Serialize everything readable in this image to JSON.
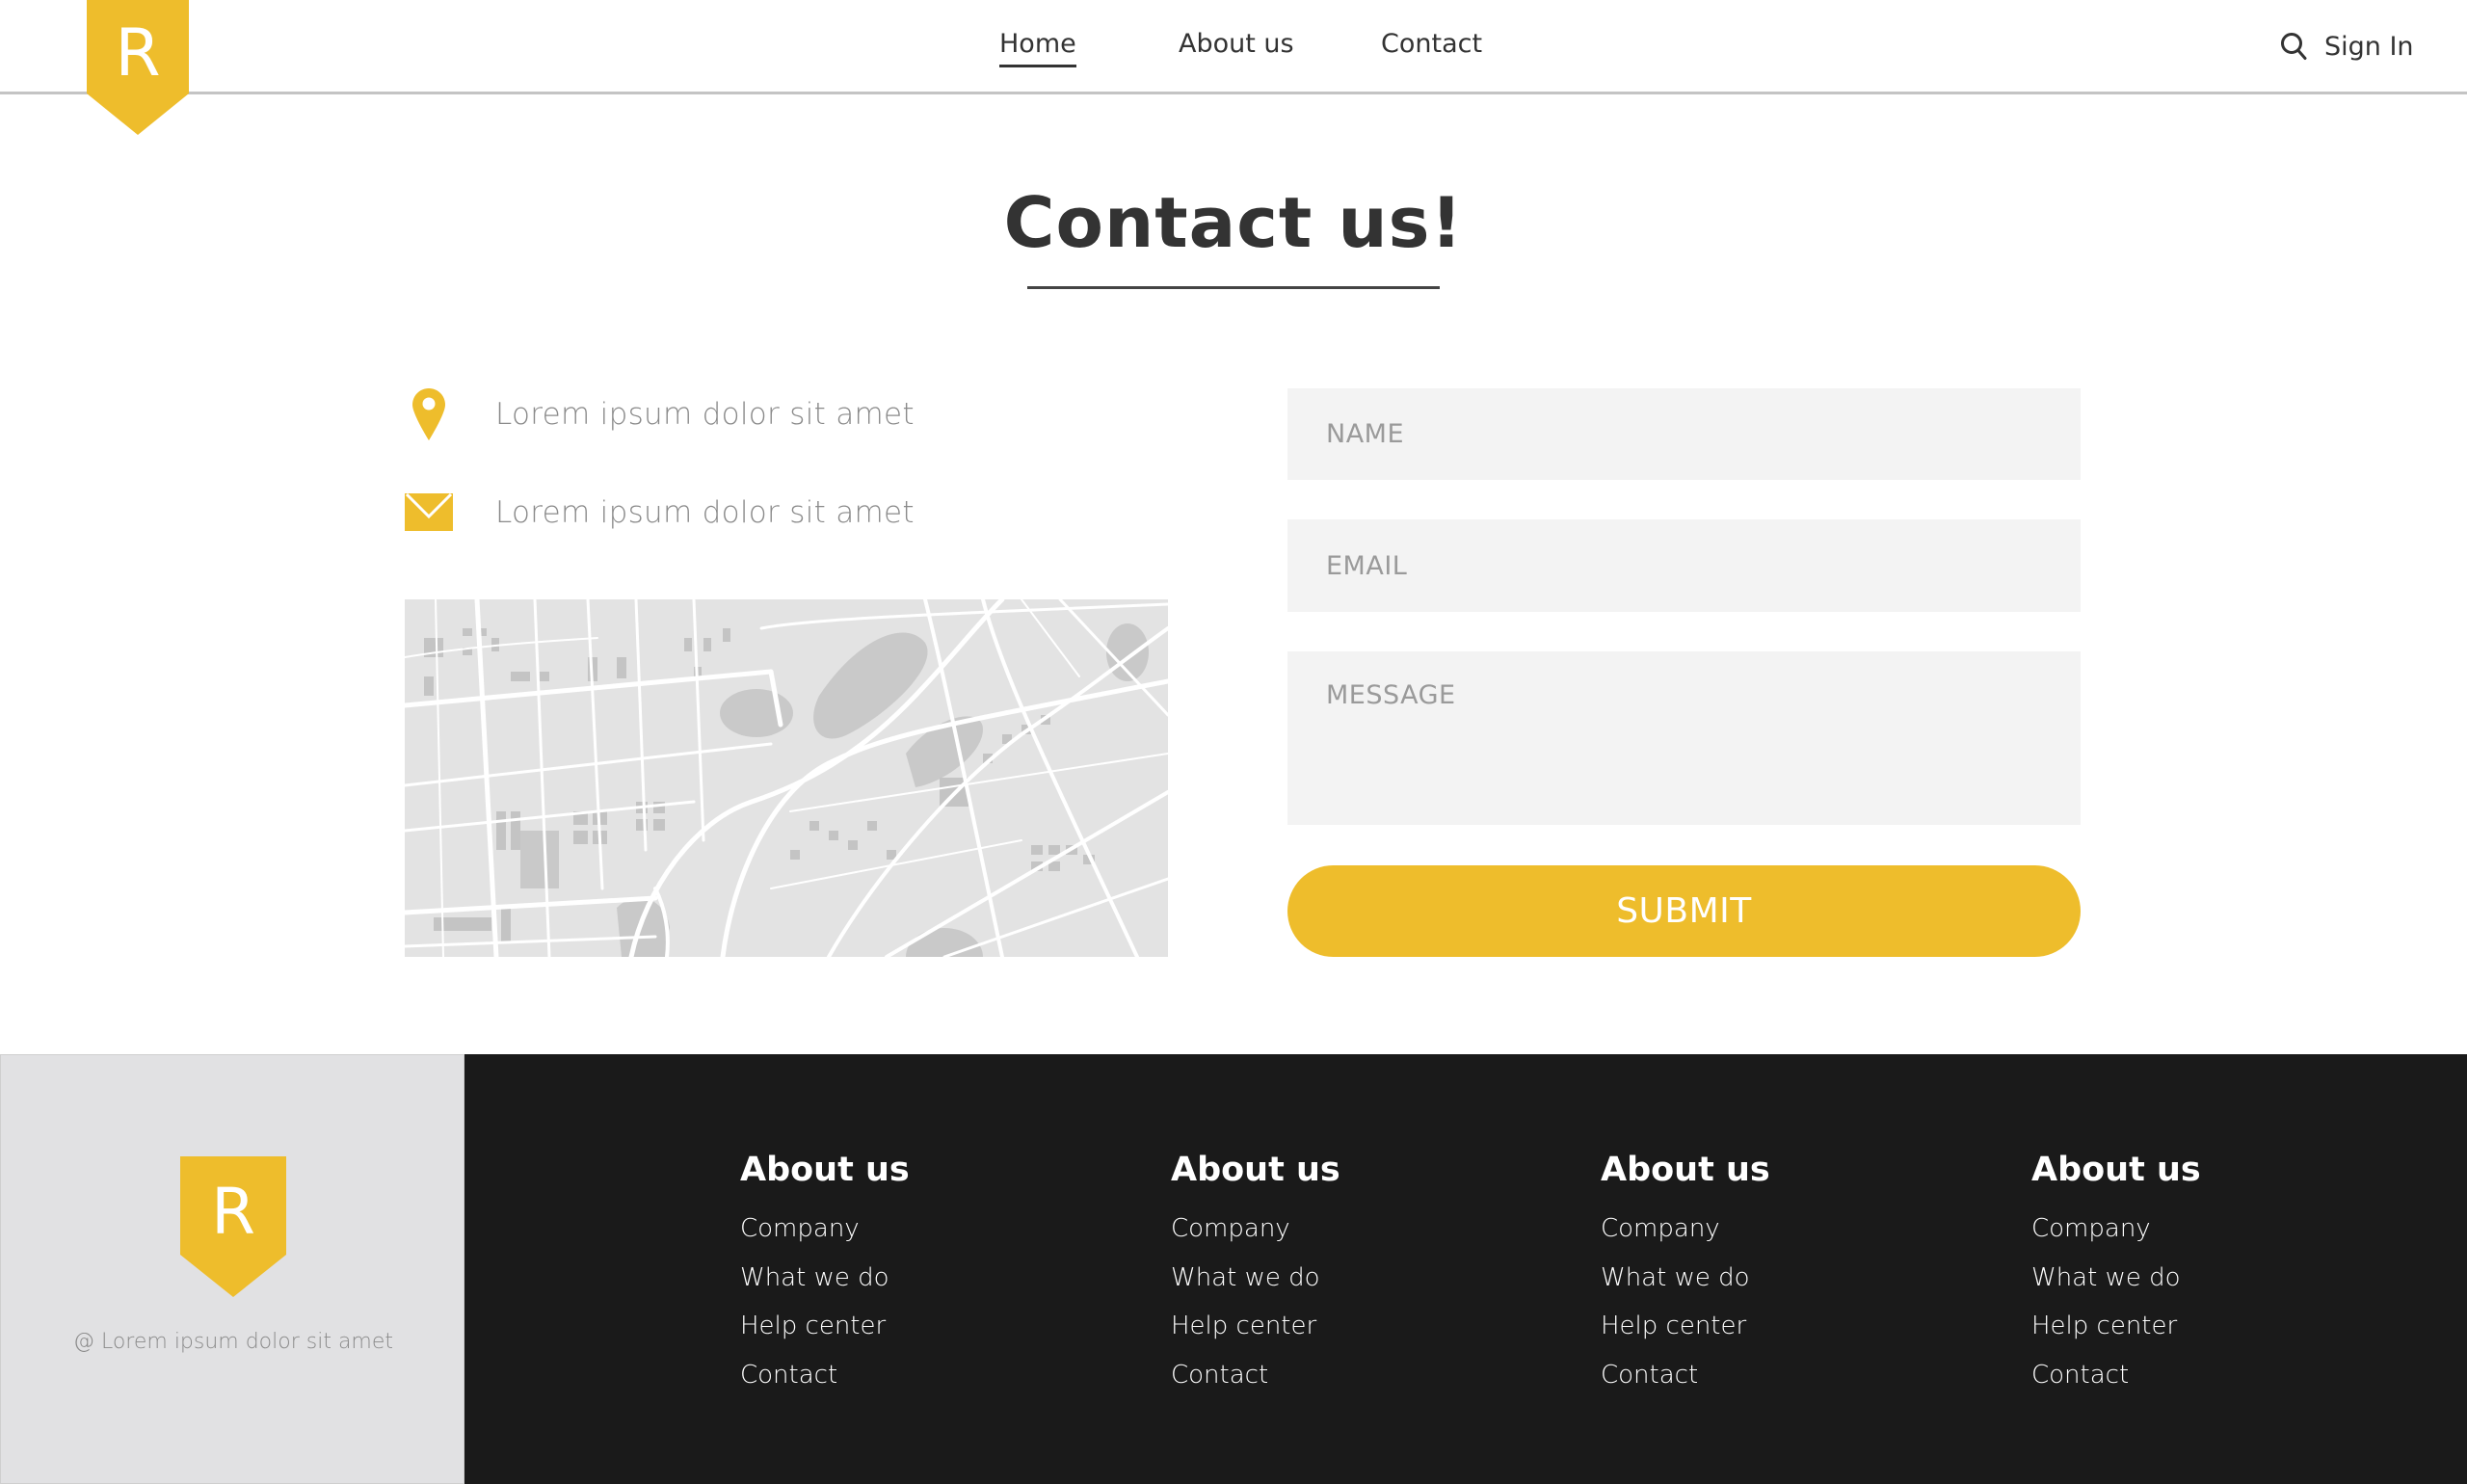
{
  "brand": {
    "logo_letter": "R",
    "accent_color": "#eebd2c"
  },
  "header": {
    "nav": [
      {
        "label": "Home",
        "active": true
      },
      {
        "label": "About us",
        "active": false
      },
      {
        "label": "Contact",
        "active": false
      }
    ],
    "search_icon": "search-icon",
    "signin_label": "Sign In"
  },
  "main": {
    "title": "Contact us!",
    "info": [
      {
        "icon": "map-pin-icon",
        "text": "Lorem ipsum dolor sit amet"
      },
      {
        "icon": "envelope-icon",
        "text": "Lorem ipsum dolor sit amet"
      }
    ],
    "map": {
      "description": "city street map (grayscale)"
    },
    "form": {
      "name_placeholder": "NAME",
      "name_value": "",
      "email_placeholder": "EMAIL",
      "email_value": "",
      "message_placeholder": "MESSAGE",
      "message_value": "",
      "submit_label": "SUBMIT"
    }
  },
  "footer": {
    "logo_letter": "R",
    "copyright": "@ Lorem ipsum dolor sit amet",
    "columns": [
      {
        "heading": "About us",
        "links": [
          "Company",
          "What we do",
          "Help center",
          "Contact"
        ]
      },
      {
        "heading": "About us",
        "links": [
          "Company",
          "What we do",
          "Help center",
          "Contact"
        ]
      },
      {
        "heading": "About us",
        "links": [
          "Company",
          "What we do",
          "Help center",
          "Contact"
        ]
      },
      {
        "heading": "About us",
        "links": [
          "Company",
          "What we do",
          "Help center",
          "Contact"
        ]
      }
    ]
  }
}
